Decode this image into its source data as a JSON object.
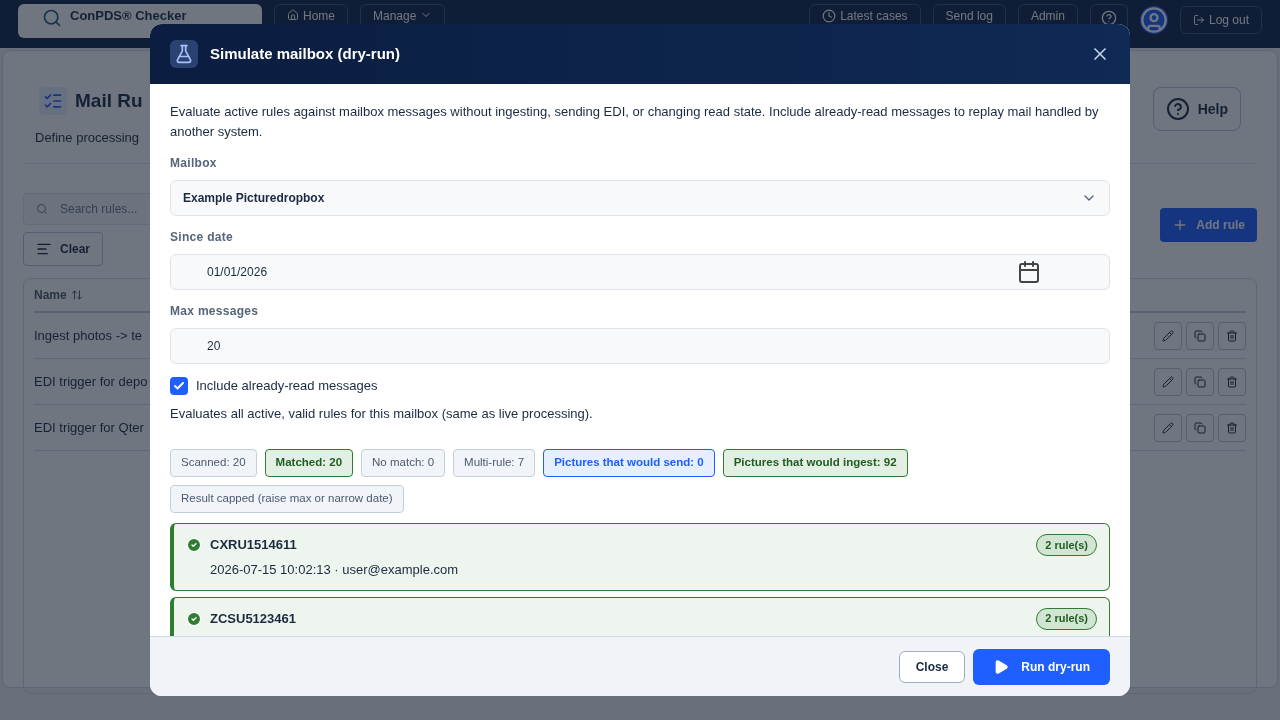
{
  "topbar": {
    "brand": "ConPDS® Checker",
    "nav": [
      {
        "label": "Home",
        "kind": "home"
      },
      {
        "label": "Manage",
        "kind": "menu"
      }
    ],
    "right": [
      {
        "label": "Latest cases",
        "kind": "clock"
      },
      {
        "label": "Send log",
        "kind": "plain"
      },
      {
        "label": "Admin",
        "kind": "plain"
      }
    ],
    "logout": "Log out"
  },
  "page": {
    "title": "Mail Ru",
    "subtitle": "Define processing",
    "help": "Help",
    "search_placeholder": "Search rules...",
    "clear": "Clear",
    "add_rule": "Add rule",
    "table": {
      "columns": [
        "Name"
      ],
      "rows": [
        "Ingest photos -> te",
        "EDI trigger for depo",
        "EDI trigger for Qter"
      ]
    }
  },
  "dialog": {
    "title": "Simulate mailbox (dry-run)",
    "description": "Evaluate active rules against mailbox messages without ingesting, sending EDI, or changing read state. Include already-read messages to replay mail handled by another system.",
    "mailbox": {
      "label": "Mailbox",
      "value": "Example Picturedropbox"
    },
    "since": {
      "label": "Since date",
      "value": "01/01/2026"
    },
    "max": {
      "label": "Max messages",
      "value": "20"
    },
    "include_read": {
      "label": "Include already-read messages",
      "checked": true
    },
    "note": "Evaluates all active, valid rules for this mailbox (same as live processing).",
    "stats": [
      {
        "label": "Scanned: 20",
        "kind": "neutral"
      },
      {
        "label": "Matched: 20",
        "kind": "success"
      },
      {
        "label": "No match: 0",
        "kind": "neutral"
      },
      {
        "label": "Multi-rule: 7",
        "kind": "neutral"
      },
      {
        "label": "Pictures that would send: 0",
        "kind": "info"
      },
      {
        "label": "Pictures that would ingest: 92",
        "kind": "success"
      },
      {
        "label": "Result capped (raise max or narrow date)",
        "kind": "neutral"
      }
    ],
    "results": [
      {
        "id": "CXRU1514611",
        "meta": "2026-07-15 10:02:13 · user@example.com",
        "rules": "2 rule(s)",
        "matched": true
      },
      {
        "id": "ZCSU5123461",
        "rules": "2 rule(s)",
        "matched": true
      }
    ],
    "buttons": {
      "close": "Close",
      "run": "Run dry-run"
    }
  }
}
